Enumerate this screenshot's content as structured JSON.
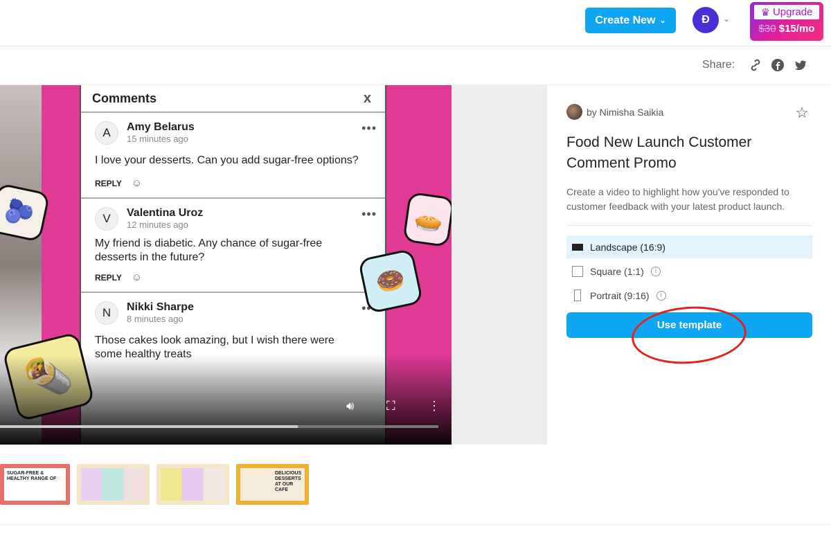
{
  "header": {
    "create_new": "Create New",
    "avatar_initial": "Đ",
    "upgrade_label": "Upgrade",
    "old_price": "$30",
    "new_price": "$15/mo"
  },
  "share": {
    "label": "Share:",
    "icons": [
      "link-icon",
      "facebook-icon",
      "twitter-icon"
    ]
  },
  "video": {
    "comments_title": "Comments",
    "close": "x",
    "reply": "REPLY",
    "progress_percent": 68,
    "comments": [
      {
        "initial": "A",
        "name": "Amy Belarus",
        "time": "15 minutes ago",
        "text": "I love your desserts. Can you add sugar-free options?"
      },
      {
        "initial": "V",
        "name": "Valentina Uroz",
        "time": "12 minutes ago",
        "text": "My friend is diabetic. Any chance of sugar-free desserts in the future?"
      },
      {
        "initial": "N",
        "name": "Nikki Sharpe",
        "time": "8 minutes ago",
        "text": "Those cakes look amazing, but I wish there were some healthy treats"
      }
    ]
  },
  "thumbnails": [
    {
      "text": "SUGAR-FREE & HEALTHY RANGE OF",
      "bg": "#e8706a"
    },
    {
      "text": "",
      "bg": "#f5e6c8"
    },
    {
      "text": "",
      "bg": "#f5e6c8"
    },
    {
      "text": "DELICIOUS DESSERTS AT OUR CAFE",
      "bg": "#f0b030"
    }
  ],
  "details": {
    "author": "by Nimisha Saikia",
    "title": "Food New Launch Customer Comment Promo",
    "description": "Create a video to highlight how you've responded to customer feedback with your latest product launch.",
    "formats": [
      {
        "label": "Landscape (16:9)",
        "selected": true
      },
      {
        "label": "Square (1:1)"
      },
      {
        "label": "Portrait (9:16)"
      }
    ],
    "use_template": "Use template"
  },
  "colors": {
    "accent": "#0ea5f3",
    "annotation": "#e52020",
    "video_bg": "#e03a95"
  }
}
